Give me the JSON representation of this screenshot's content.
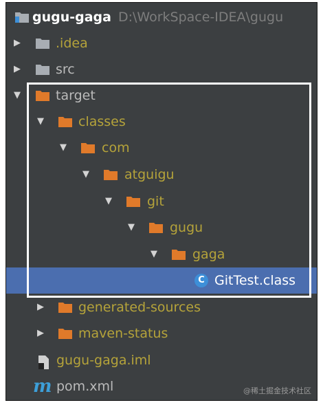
{
  "project": {
    "name": "gugu-gaga",
    "path": "D:\\WorkSpace-IDEA\\gugu"
  },
  "tree": {
    "idea": ".idea",
    "src": "src",
    "target": "target",
    "classes": "classes",
    "com": "com",
    "atguigu": "atguigu",
    "git": "git",
    "gugu": "gugu",
    "gaga": "gaga",
    "class_file": {
      "icon_letter": "C",
      "name": "GitTest.class"
    },
    "generated_sources": "generated-sources",
    "maven_status": "maven-status",
    "iml_file": "gugu-gaga.iml",
    "pom_file": {
      "icon_letter": "m",
      "name": "pom.xml"
    }
  },
  "icons": {
    "expanded": "arrow-down-icon",
    "collapsed": "arrow-right-icon",
    "folder_excluded": "orange-folder-icon",
    "folder_plain": "gray-folder-icon",
    "class": "class-file-icon",
    "maven": "maven-icon",
    "module": "module-file-icon"
  },
  "colors": {
    "panel_bg": "#3c3f41",
    "selection": "#4b6eaf",
    "excluded_text": "#b5a33a",
    "excluded_folder": "#e07a2a",
    "plain_folder": "#a8adb3",
    "class_icon": "#3d8fd8",
    "highlight_box": "#ffffff"
  },
  "watermark": "@稀土掘金技术社区"
}
